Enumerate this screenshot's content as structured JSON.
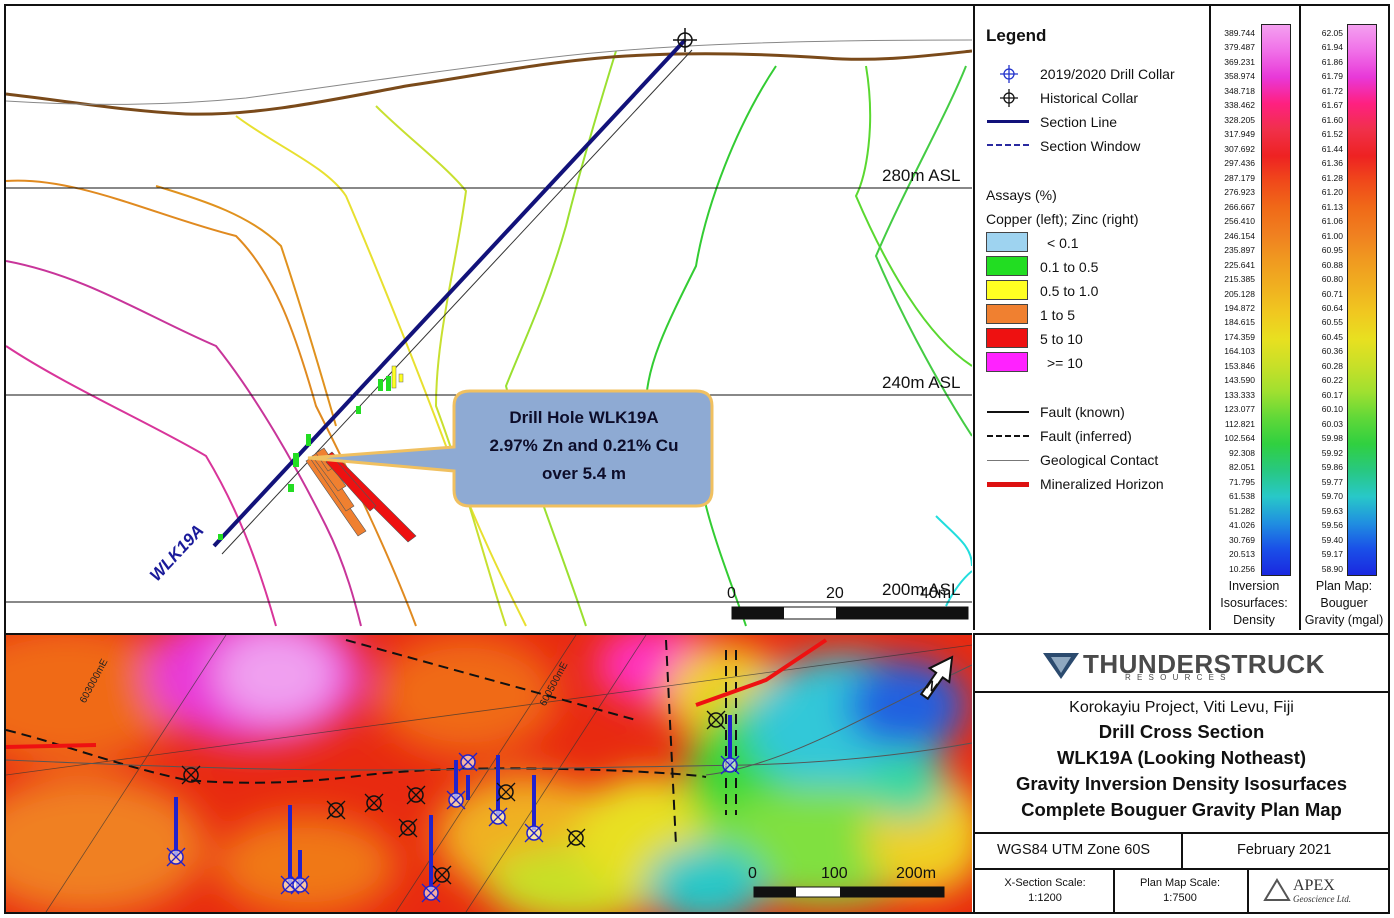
{
  "section": {
    "elev_labels": [
      "280m ASL",
      "240m ASL",
      "200m ASL"
    ],
    "hole_label": "WLK19A",
    "callout": {
      "line1": "Drill Hole WLK19A",
      "line2": "2.97% Zn and 0.21% Cu",
      "line3": "over 5.4 m"
    },
    "scale_labels": [
      "0",
      "20",
      "40m"
    ]
  },
  "legend": {
    "title": "Legend",
    "symbols": [
      {
        "label": "2019/2020 Drill Collar",
        "color": "#2233cc"
      },
      {
        "label": "Historical Collar",
        "color": "#111111"
      },
      {
        "label": "Section Line",
        "color": "#12127a"
      },
      {
        "label": "Section Window",
        "color": "#2a2aa0"
      }
    ],
    "assays_title": "Assays (%)",
    "assays_subtitle": "Copper (left); Zinc (right)",
    "assays": [
      {
        "label": "< 0.1",
        "color": "#9ed3f0"
      },
      {
        "label": "0.1 to 0.5",
        "color": "#22dd22"
      },
      {
        "label": "0.5 to 1.0",
        "color": "#ffff22"
      },
      {
        "label": "1 to 5",
        "color": "#f08030"
      },
      {
        "label": "5 to 10",
        "color": "#ee1111"
      },
      {
        "label": ">= 10",
        "color": "#ff22ff"
      }
    ],
    "lines": [
      {
        "label": "Fault (known)"
      },
      {
        "label": "Fault (inferred)"
      },
      {
        "label": "Geological Contact"
      },
      {
        "label": "Mineralized Horizon",
        "color": "#dd1111"
      }
    ]
  },
  "density_scale": {
    "values": [
      "389.744",
      "379.487",
      "369.231",
      "358.974",
      "348.718",
      "338.462",
      "328.205",
      "317.949",
      "307.692",
      "297.436",
      "287.179",
      "276.923",
      "266.667",
      "256.410",
      "246.154",
      "235.897",
      "225.641",
      "215.385",
      "205.128",
      "194.872",
      "184.615",
      "174.359",
      "164.103",
      "153.846",
      "143.590",
      "133.333",
      "123.077",
      "112.821",
      "102.564",
      "92.308",
      "82.051",
      "71.795",
      "61.538",
      "51.282",
      "41.026",
      "30.769",
      "20.513",
      "10.256"
    ],
    "caption": [
      "Inversion",
      "Isosurfaces:",
      "Density"
    ]
  },
  "gravity_scale": {
    "values": [
      "62.05",
      "61.94",
      "61.86",
      "61.79",
      "61.72",
      "61.67",
      "61.60",
      "61.52",
      "61.44",
      "61.36",
      "61.28",
      "61.20",
      "61.13",
      "61.06",
      "61.00",
      "60.95",
      "60.88",
      "60.80",
      "60.71",
      "60.64",
      "60.55",
      "60.45",
      "60.36",
      "60.28",
      "60.22",
      "60.17",
      "60.10",
      "60.03",
      "59.98",
      "59.92",
      "59.86",
      "59.77",
      "59.70",
      "59.63",
      "59.56",
      "59.40",
      "59.17",
      "58.90"
    ],
    "caption": [
      "Plan Map:",
      "Bouguer",
      "Gravity (mgal)"
    ]
  },
  "planmap": {
    "grid_labels": [
      "603000mE",
      "600500mE"
    ],
    "scale_labels": [
      "0",
      "100",
      "200m"
    ]
  },
  "title_block": {
    "company": "THUNDERSTRUCK",
    "company_sub": "R E S O U R C E S",
    "project": "Korokayiu Project, Viti Levu, Fiji",
    "lines": [
      "Drill Cross Section",
      "WLK19A (Looking Notheast)",
      "Gravity Inversion Density Isosurfaces",
      "Complete Bouguer Gravity Plan Map"
    ],
    "datum": "WGS84 UTM Zone 60S",
    "date": "February 2021",
    "xs_scale_label": "X-Section Scale:",
    "xs_scale": "1:1200",
    "plan_scale_label": "Plan Map Scale:",
    "plan_scale": "1:7500",
    "apex": "APEX",
    "apex_sub": "Geoscience Ltd."
  }
}
